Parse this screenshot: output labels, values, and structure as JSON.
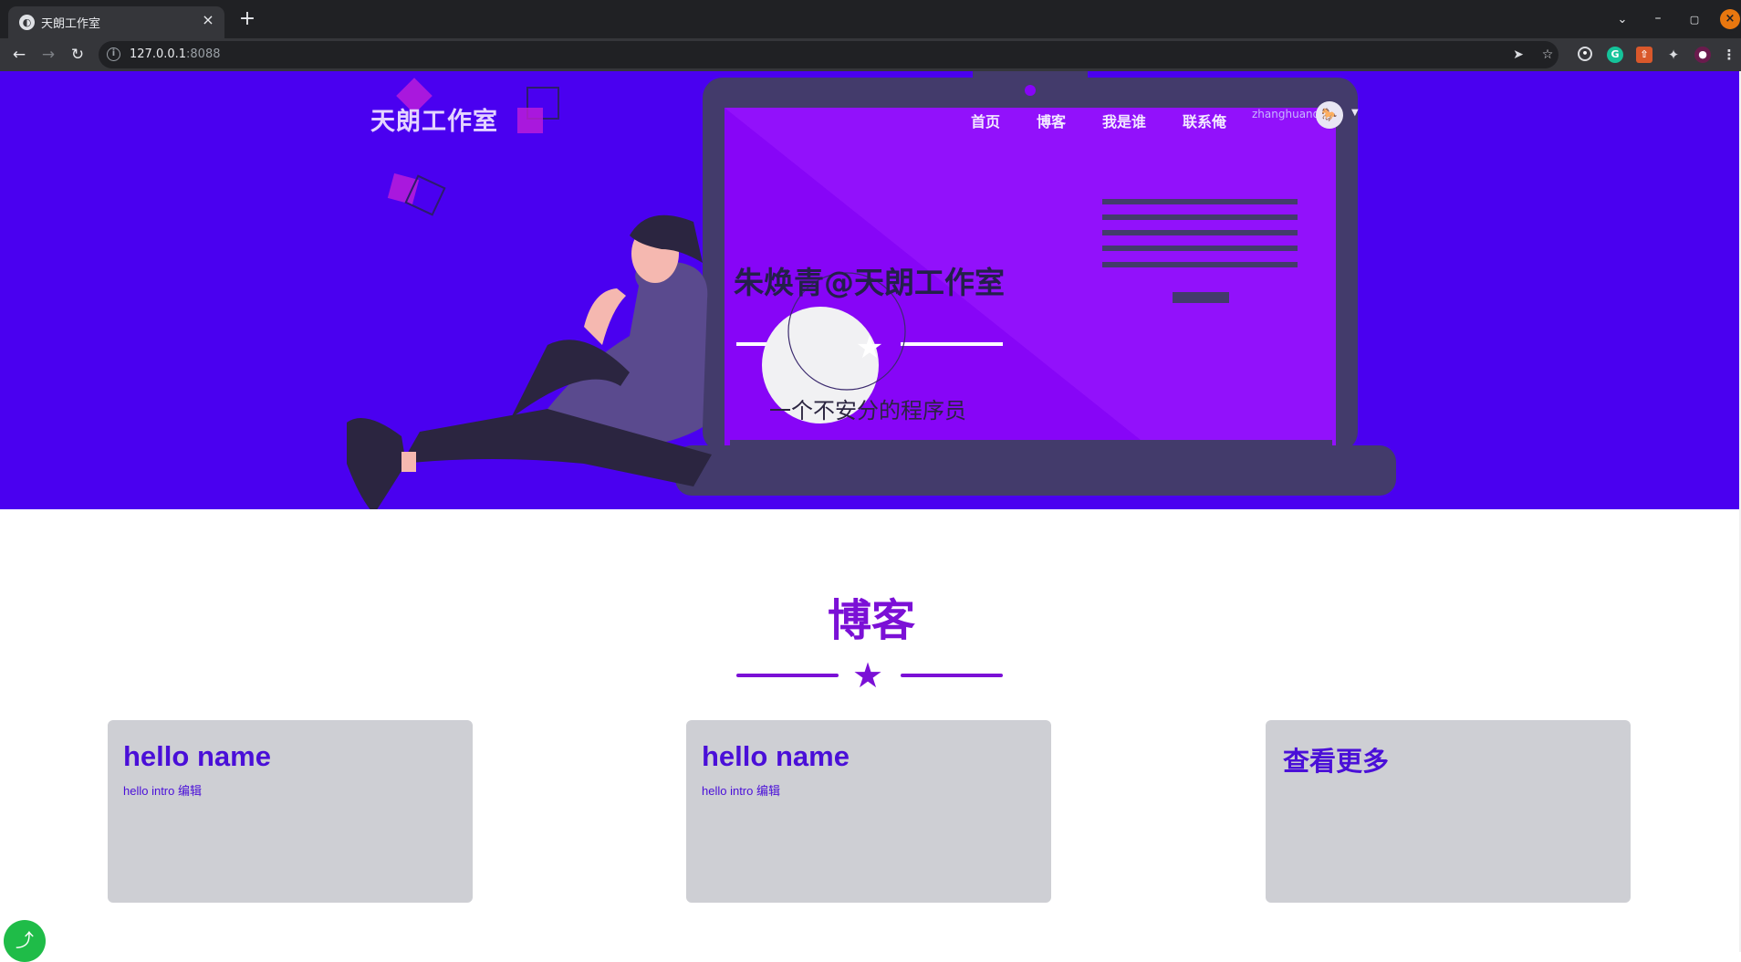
{
  "browser": {
    "tab_title": "天朗工作室",
    "tab_favicon": "tianlang-favicon",
    "url_host": "127.0.0.1",
    "url_port": ":8088",
    "icons": [
      "back-icon",
      "forward-icon",
      "reload-icon",
      "info-icon",
      "send-icon",
      "bookmark-star-icon",
      "extension-icon",
      "grammarly-icon",
      "puzzle-icon",
      "menu-icon"
    ]
  },
  "header": {
    "brand": "天朗工作室",
    "nav": [
      "首页",
      "博客",
      "我是谁",
      "联系俺"
    ],
    "username": "zhanghuanqing",
    "avatar_glyph": "🐎"
  },
  "hero": {
    "title": "朱焕青@天朗工作室",
    "subtitle": "一个不安分的程序员",
    "background_color": "#4a00f0",
    "screen_color": "#8705f7"
  },
  "blog": {
    "section_title": "博客",
    "divider_star": "★",
    "cards": [
      {
        "title": "hello name",
        "intro": "hello intro 编辑"
      },
      {
        "title": "hello name",
        "intro": "hello intro 编辑"
      },
      {
        "title": "查看更多",
        "intro": ""
      }
    ],
    "accent_color": "#7b10d6",
    "card_text_color": "#4a0fd8"
  },
  "share": {
    "icon": "share-icon",
    "color": "#1fbc48"
  }
}
